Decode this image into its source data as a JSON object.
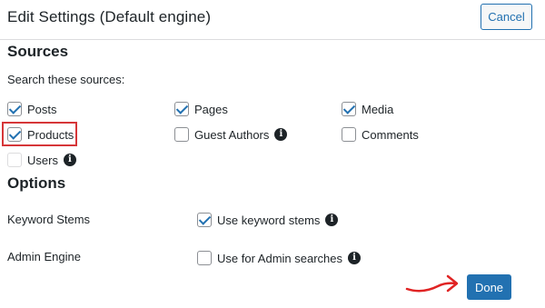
{
  "dialog": {
    "title": "Edit Settings (Default engine)",
    "cancel_label": "Cancel",
    "done_label": "Done"
  },
  "sources": {
    "heading": "Sources",
    "prompt": "Search these sources:",
    "items": [
      {
        "label": "Posts",
        "checked": true
      },
      {
        "label": "Pages",
        "checked": true
      },
      {
        "label": "Media",
        "checked": true
      },
      {
        "label": "Products",
        "checked": true,
        "highlighted": true
      },
      {
        "label": "Guest Authors",
        "checked": false,
        "info_icon": true
      },
      {
        "label": "Comments",
        "checked": false
      },
      {
        "label": "Users",
        "checked": false,
        "info_icon": true
      }
    ]
  },
  "options": {
    "heading": "Options",
    "rows": [
      {
        "label": "Keyword Stems",
        "option_label": "Use keyword stems",
        "checked": true,
        "info_icon": true
      },
      {
        "label": "Admin Engine",
        "option_label": "Use for Admin searches",
        "checked": false,
        "info_icon": true
      }
    ]
  },
  "colors": {
    "accent": "#2271b1",
    "highlight": "#d63638",
    "annotation_arrow": "#e02424"
  }
}
